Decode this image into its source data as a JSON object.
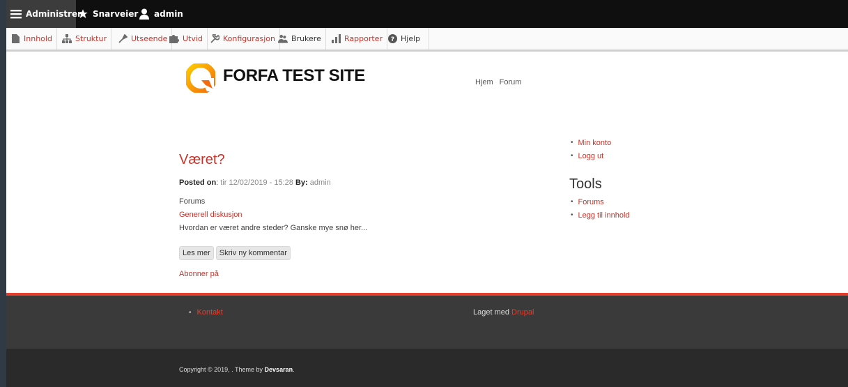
{
  "toolbar": {
    "administer": "Administrer",
    "shortcuts": "Snarveier",
    "user": "admin"
  },
  "tray": {
    "items": [
      {
        "label": "Innhold"
      },
      {
        "label": "Struktur"
      },
      {
        "label": "Utseende"
      },
      {
        "label": "Utvid"
      },
      {
        "label": "Konfigurasjon"
      },
      {
        "label": "Brukere"
      },
      {
        "label": "Rapporter"
      },
      {
        "label": "Hjelp"
      }
    ]
  },
  "site": {
    "name": "FORFA TEST SITE",
    "menu": [
      "Hjem",
      "Forum"
    ]
  },
  "article": {
    "title": "Været?",
    "posted_label": "Posted on",
    "posted_date": "tir 12/02/2019 - 15:28",
    "by_label": "By:",
    "author": "admin",
    "forums_label": "Forums",
    "forum_term": "Generell diskusjon",
    "body": "Hvordan er været andre steder? Ganske mye snø her...",
    "read_more": "Les mer",
    "add_comment": "Skriv ny kommentar",
    "subscribe": "Abonner på"
  },
  "sidebar": {
    "user_links": [
      "Min konto",
      "Logg ut"
    ],
    "tools_title": "Tools",
    "tools_links": [
      "Forums",
      "Legg til innhold"
    ]
  },
  "footer": {
    "links": [
      "Kontakt"
    ],
    "made_with": "Laget med",
    "made_with_link": "Drupal",
    "copyright_prefix": "Copyright © 2019, . Theme by",
    "theme_author": "Devsaran",
    "copyright_suffix": "."
  },
  "colors": {
    "accent": "#c7342b",
    "toolbar_bg": "#0f0f0f",
    "footer_bg": "#3a3a3a",
    "footer_rule": "#e53e2e"
  }
}
